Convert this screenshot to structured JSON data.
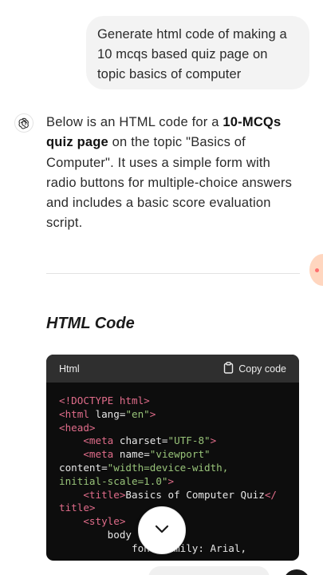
{
  "user_message": {
    "text": "Generate html code of making a 10 mcqs based quiz page on topic basics of computer"
  },
  "assistant": {
    "icon": "openai-logo-icon",
    "intro_1": "Below is an HTML code for a ",
    "bold_1": "10-MCQs quiz page",
    "intro_2": " on the topic \"Basics of Computer\". It uses a simple form with radio buttons for multiple-choice answers and includes a basic score evaluation script.",
    "section_heading": "HTML Code"
  },
  "code_block": {
    "language": "Html",
    "copy_label": "Copy code",
    "copy_icon": "clipboard-icon",
    "colors": {
      "tag": "#e06c8a",
      "string": "#98c379",
      "text": "#e6e6e6",
      "background": "#0d0d0d",
      "header": "#2f2f2f"
    }
  },
  "controls": {
    "scroll_down_icon": "chevron-down-icon"
  }
}
